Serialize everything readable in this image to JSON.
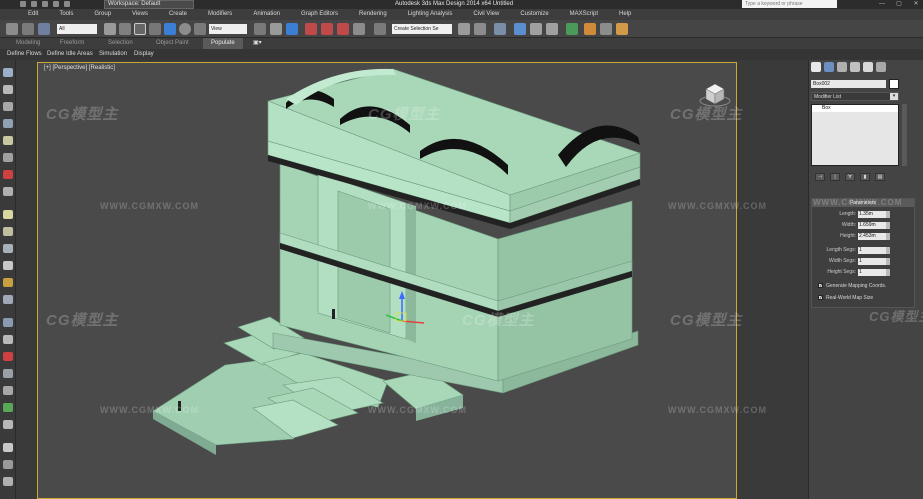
{
  "titlebar": {
    "workspace": "Workspace: Default",
    "app_title": "Autodesk 3ds Max Design 2014 x64      Untitled",
    "search_placeholder": "Type a keyword or phrase"
  },
  "menus": [
    "Edit",
    "Tools",
    "Group",
    "Views",
    "Create",
    "Modifiers",
    "Animation",
    "Graph Editors",
    "Rendering",
    "Lighting Analysis",
    "Civil View",
    "Customize",
    "MAXScript",
    "Help"
  ],
  "toolbar": {
    "selection_filter": "All",
    "ref_coord": "View",
    "named_selection": "Create Selection Se"
  },
  "ribbon_tabs": [
    "Modeling",
    "Freeform",
    "Selection",
    "Object Paint",
    "Populate"
  ],
  "active_ribbon_tab": "Populate",
  "populate_items": [
    "Define Flows",
    "Define Idle Areas",
    "Simulation",
    "Display"
  ],
  "viewport": {
    "label": "[+] [Perspective] [Realistic]",
    "border_color": "#c8a832",
    "model_color": "#a8d8b8"
  },
  "command_panel": {
    "object_name": "Box002",
    "modifier_list": "Modifier List",
    "stack_items": [
      "Box"
    ],
    "rollout_title": "Parameters",
    "params": [
      {
        "label": "Length:",
        "value": "1.35m"
      },
      {
        "label": "Width:",
        "value": "1.659m"
      },
      {
        "label": "Height:",
        "value": "2.453m"
      },
      {
        "label": "Length Segs:",
        "value": "1"
      },
      {
        "label": "Width Segs:",
        "value": "1"
      },
      {
        "label": "Height Segs:",
        "value": "1"
      }
    ],
    "checkboxes": [
      {
        "label": "Generate Mapping Coords.",
        "checked": true
      },
      {
        "label": "Real-World Map Size",
        "checked": true
      }
    ]
  },
  "watermark": {
    "logo": "CG模型主",
    "url": "WWW.CGMXW.COM"
  }
}
